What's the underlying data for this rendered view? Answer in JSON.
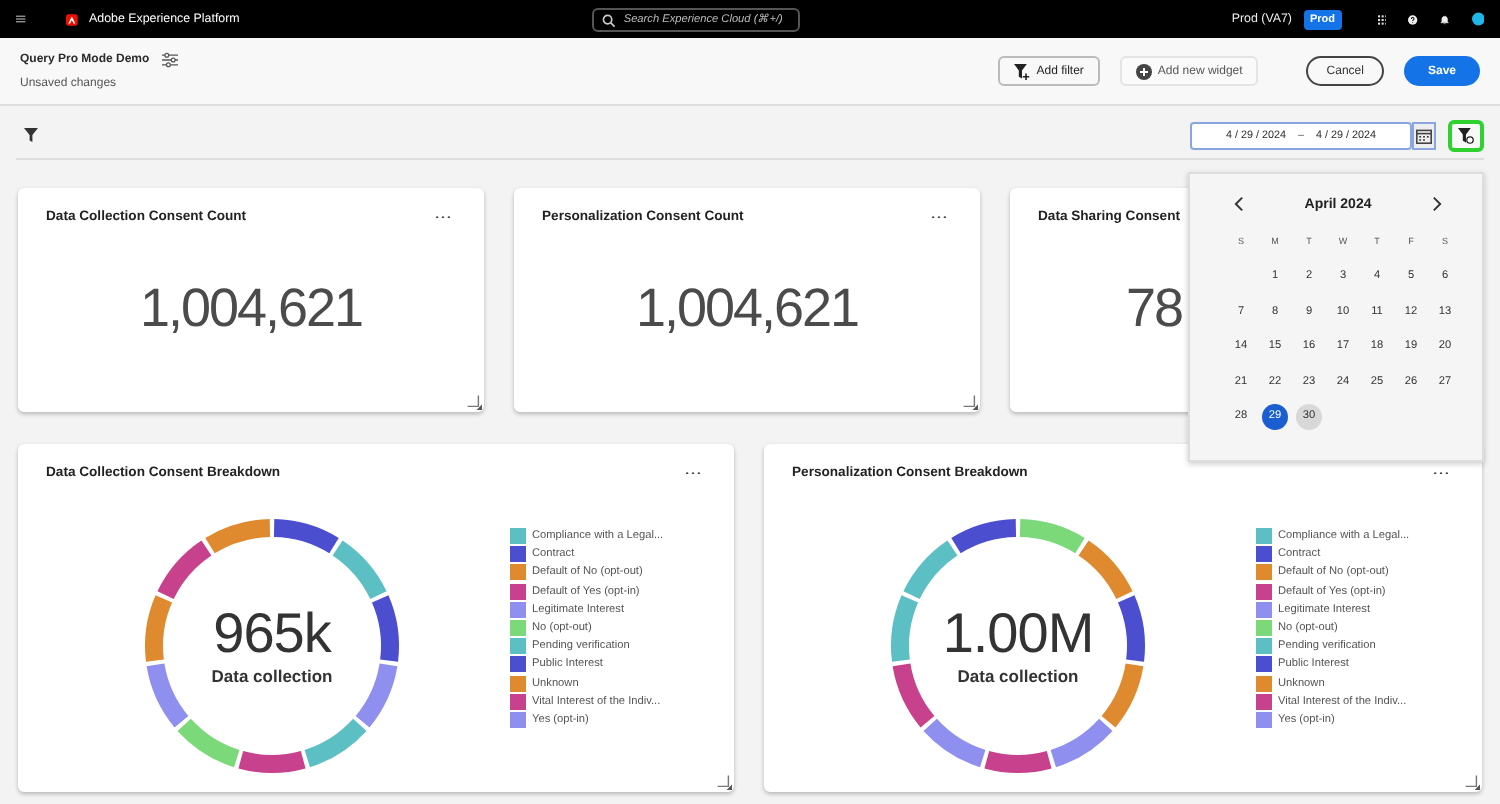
{
  "topbar": {
    "app_name": "Adobe Experience Platform",
    "search": {
      "placeholder": "Search Experience Cloud (⌘+/)"
    },
    "org": "Prod (VA7)",
    "env_badge": "Prod"
  },
  "header": {
    "title": "Query Pro Mode Demo",
    "status": "Unsaved changes",
    "buttons": [
      {
        "label": "Add filter",
        "kind": "filter"
      },
      {
        "label": "Add new widget",
        "kind": "add"
      },
      {
        "label": "Cancel",
        "kind": "outline"
      },
      {
        "label": "Save",
        "kind": "primary"
      }
    ]
  },
  "date_range": {
    "start": "4 / 29 / 2024",
    "separator": "–",
    "end": "4 / 29 / 2024"
  },
  "filter_toggle": {
    "on": true
  },
  "calendar": {
    "month": "April 2024",
    "weekdays": [
      "S",
      "M",
      "T",
      "W",
      "T",
      "F",
      "S"
    ],
    "weeks": [
      [
        {
          "day": "1",
          "selected": false,
          "highlighted": false
        },
        {
          "day": "2",
          "selected": false,
          "highlighted": false
        },
        {
          "day": "3",
          "selected": false,
          "highlighted": false
        },
        {
          "day": "4",
          "selected": false,
          "highlighted": false
        },
        {
          "day": "5",
          "selected": false,
          "highlighted": false
        },
        {
          "day": "6",
          "selected": false,
          "highlighted": false
        }
      ],
      [
        {
          "day": "7",
          "selected": false,
          "highlighted": false
        },
        {
          "day": "8",
          "selected": false,
          "highlighted": false
        },
        {
          "day": "9",
          "selected": false,
          "highlighted": false
        },
        {
          "day": "10",
          "selected": false,
          "highlighted": false
        },
        {
          "day": "11",
          "selected": false,
          "highlighted": false
        },
        {
          "day": "12",
          "selected": false,
          "highlighted": false
        },
        {
          "day": "13",
          "selected": false,
          "highlighted": false
        }
      ],
      [
        {
          "day": "14",
          "selected": false,
          "highlighted": false
        },
        {
          "day": "15",
          "selected": false,
          "highlighted": false
        },
        {
          "day": "16",
          "selected": false,
          "highlighted": false
        },
        {
          "day": "17",
          "selected": false,
          "highlighted": false
        },
        {
          "day": "18",
          "selected": false,
          "highlighted": false
        },
        {
          "day": "19",
          "selected": false,
          "highlighted": false
        },
        {
          "day": "20",
          "selected": false,
          "highlighted": false
        }
      ],
      [
        {
          "day": "21",
          "selected": false,
          "highlighted": false
        },
        {
          "day": "22",
          "selected": false,
          "highlighted": false
        },
        {
          "day": "23",
          "selected": false,
          "highlighted": false
        },
        {
          "day": "24",
          "selected": false,
          "highlighted": false
        },
        {
          "day": "25",
          "selected": false,
          "highlighted": false
        },
        {
          "day": "26",
          "selected": false,
          "highlighted": false
        },
        {
          "day": "27",
          "selected": false,
          "highlighted": false
        }
      ],
      [
        {
          "day": "28",
          "selected": false,
          "highlighted": false
        },
        {
          "day": "29",
          "selected": true,
          "highlighted": false
        },
        {
          "day": "30",
          "selected": false,
          "highlighted": true
        }
      ]
    ]
  },
  "count_cards": [
    {
      "title": "Data Collection Consent Count",
      "value": "1,004,621",
      "cut": false
    },
    {
      "title": "Personalization Consent Count",
      "value": "1,004,621",
      "cut": false
    },
    {
      "title": "Data Sharing Consent",
      "value": "78",
      "cut": true
    }
  ],
  "breakdown_cards": [
    {
      "title": "Data Collection Consent Breakdown",
      "total": "965k",
      "caption": "Data collection",
      "segments": [
        {
          "color": "#4b4fcf"
        },
        {
          "color": "#5bbfc4"
        },
        {
          "color": "#4b4fcf"
        },
        {
          "color": "#8f8ff0"
        },
        {
          "color": "#5bbfc4"
        },
        {
          "color": "#c8418c"
        },
        {
          "color": "#7bd97a"
        },
        {
          "color": "#8f8ff0"
        },
        {
          "color": "#e08a2f"
        },
        {
          "color": "#c8418c"
        },
        {
          "color": "#e08a2f"
        }
      ],
      "legend": [
        {
          "label": "Compliance with a Legal...",
          "color": "#5bbfc4"
        },
        {
          "label": "Contract",
          "color": "#4b4fcf"
        },
        {
          "label": "Default of No (opt-out)",
          "color": "#e08a2f"
        },
        {
          "label": "Default of Yes (opt-in)",
          "color": "#c8418c"
        },
        {
          "label": "Legitimate Interest",
          "color": "#8f8ff0"
        },
        {
          "label": "No (opt-out)",
          "color": "#7bd97a"
        },
        {
          "label": "Pending verification",
          "color": "#5bbfc4"
        },
        {
          "label": "Public Interest",
          "color": "#4b4fcf"
        },
        {
          "label": "Unknown",
          "color": "#e08a2f"
        },
        {
          "label": "Vital Interest of the Indiv...",
          "color": "#c8418c"
        },
        {
          "label": "Yes (opt-in)",
          "color": "#8f8ff0"
        }
      ]
    },
    {
      "title": "Personalization Consent Breakdown",
      "total": "1.00M",
      "caption": "Data collection",
      "segments": [
        {
          "color": "#7bd97a"
        },
        {
          "color": "#e08a2f"
        },
        {
          "color": "#4b4fcf"
        },
        {
          "color": "#e08a2f"
        },
        {
          "color": "#8f8ff0"
        },
        {
          "color": "#c8418c"
        },
        {
          "color": "#8f8ff0"
        },
        {
          "color": "#c8418c"
        },
        {
          "color": "#5bbfc4"
        },
        {
          "color": "#5bbfc4"
        },
        {
          "color": "#4b4fcf"
        }
      ],
      "legend": [
        {
          "label": "Compliance with a Legal...",
          "color": "#5bbfc4"
        },
        {
          "label": "Contract",
          "color": "#4b4fcf"
        },
        {
          "label": "Default of No (opt-out)",
          "color": "#e08a2f"
        },
        {
          "label": "Default of Yes (opt-in)",
          "color": "#c8418c"
        },
        {
          "label": "Legitimate Interest",
          "color": "#8f8ff0"
        },
        {
          "label": "No (opt-out)",
          "color": "#7bd97a"
        },
        {
          "label": "Pending verification",
          "color": "#5bbfc4"
        },
        {
          "label": "Public Interest",
          "color": "#4b4fcf"
        },
        {
          "label": "Unknown",
          "color": "#e08a2f"
        },
        {
          "label": "Vital Interest of the Indiv...",
          "color": "#c8418c"
        },
        {
          "label": "Yes (opt-in)",
          "color": "#8f8ff0"
        }
      ]
    }
  ]
}
